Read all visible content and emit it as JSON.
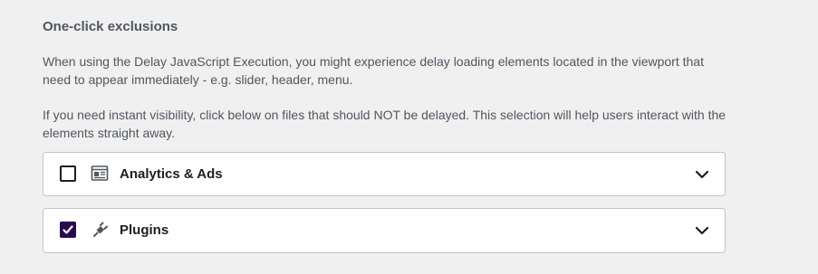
{
  "section": {
    "title": "One-click exclusions",
    "description_1": "When using the Delay JavaScript Execution, you might experience delay loading elements located in the viewport that need to appear immediately - e.g. slider, header, menu.",
    "description_2": "If you need instant visibility, click below on files that should NOT be delayed. This selection will help users interact with the elements straight away."
  },
  "groups": [
    {
      "label": "Analytics & Ads",
      "checked": false,
      "icon": "analytics-ads-icon",
      "expanded": false
    },
    {
      "label": "Plugins",
      "checked": true,
      "icon": "plugin-icon",
      "expanded": false
    }
  ],
  "colors": {
    "background": "#f0f0f1",
    "card_border": "#c3c4c7",
    "checkbox_checked": "#2a0c4e",
    "text": "#50575e",
    "label": "#1e1e1e"
  }
}
